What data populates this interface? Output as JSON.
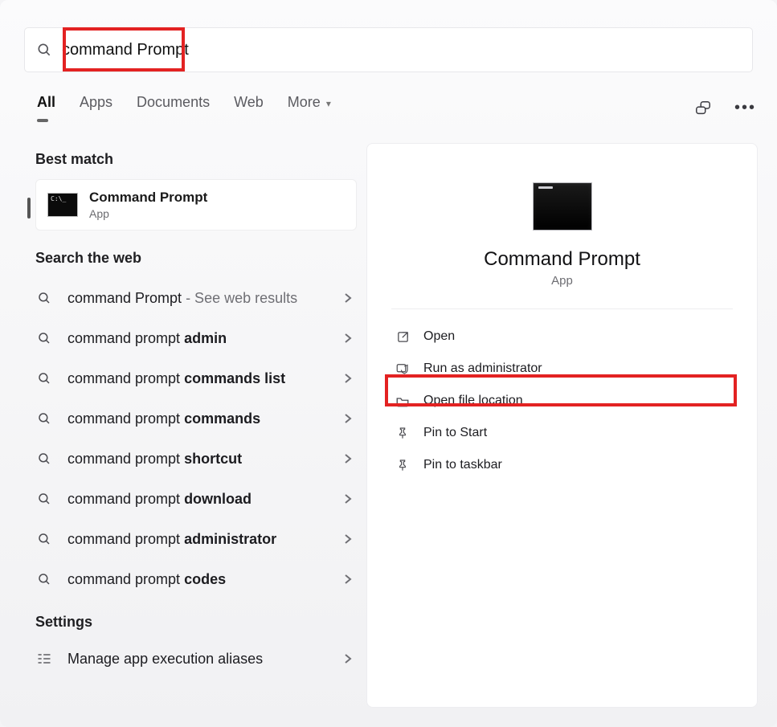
{
  "search": {
    "query": "command Prompt"
  },
  "filters": {
    "tabs": [
      "All",
      "Apps",
      "Documents",
      "Web",
      "More"
    ]
  },
  "left": {
    "best_match_label": "Best match",
    "best_title": "Command Prompt",
    "best_sub": "App",
    "search_web_label": "Search the web",
    "web_items": [
      {
        "prefix": "command Prompt",
        "bold": "",
        "suffix": " - See web results"
      },
      {
        "prefix": "command prompt ",
        "bold": "admin",
        "suffix": ""
      },
      {
        "prefix": "command prompt ",
        "bold": "commands list",
        "suffix": ""
      },
      {
        "prefix": "command prompt ",
        "bold": "commands",
        "suffix": ""
      },
      {
        "prefix": "command prompt ",
        "bold": "shortcut",
        "suffix": ""
      },
      {
        "prefix": "command prompt ",
        "bold": "download",
        "suffix": ""
      },
      {
        "prefix": "command prompt ",
        "bold": "administrator",
        "suffix": ""
      },
      {
        "prefix": "command prompt ",
        "bold": "codes",
        "suffix": ""
      }
    ],
    "settings_label": "Settings",
    "settings_items": [
      {
        "label": "Manage app execution aliases"
      }
    ]
  },
  "preview": {
    "title": "Command Prompt",
    "sub": "App",
    "actions": [
      {
        "icon": "open",
        "label": "Open"
      },
      {
        "icon": "shield",
        "label": "Run as administrator"
      },
      {
        "icon": "folder",
        "label": "Open file location"
      },
      {
        "icon": "pin",
        "label": "Pin to Start"
      },
      {
        "icon": "pin",
        "label": "Pin to taskbar"
      }
    ]
  }
}
